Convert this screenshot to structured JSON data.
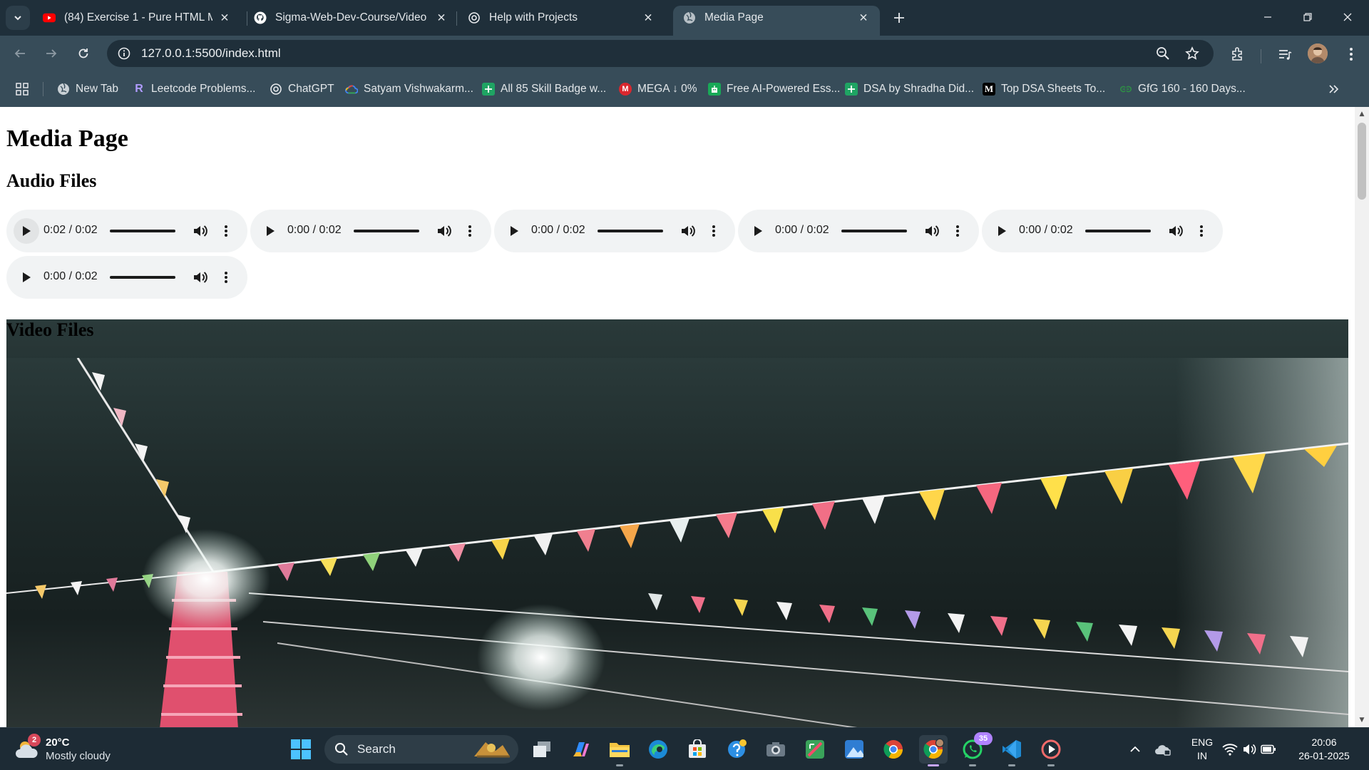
{
  "browser": {
    "tabs": [
      {
        "title": "(84) Exercise 1 - Pure HTML Me",
        "favicon": "youtube-icon",
        "active": false
      },
      {
        "title": "Sigma-Web-Dev-Course/Video",
        "favicon": "github-icon",
        "active": false
      },
      {
        "title": "Help with Projects",
        "favicon": "chatgpt-icon",
        "active": false
      },
      {
        "title": "Media Page",
        "favicon": "globe-icon",
        "active": true
      }
    ],
    "address": "127.0.0.1:5500/index.html",
    "bookmarks": [
      {
        "label": "New Tab",
        "icon": "globe-icon"
      },
      {
        "label": "Leetcode Problems...",
        "icon": "leetcode-icon"
      },
      {
        "label": "ChatGPT",
        "icon": "chatgpt-icon"
      },
      {
        "label": "Satyam Vishwakarm...",
        "icon": "google-cloud-icon"
      },
      {
        "label": "All 85 Skill Badge w...",
        "icon": "sheets-icon"
      },
      {
        "label": "MEGA ↓ 0%",
        "icon": "mega-icon"
      },
      {
        "label": "Free AI-Powered Ess...",
        "icon": "essay-icon"
      },
      {
        "label": "DSA by Shradha Did...",
        "icon": "sheets-icon"
      },
      {
        "label": "Top DSA Sheets To...",
        "icon": "medium-icon"
      },
      {
        "label": "GfG 160 - 160 Days...",
        "icon": "gfg-icon"
      }
    ],
    "bookmark_icon_text": {
      "medium": "M",
      "mega": "M",
      "leetcode": "R"
    }
  },
  "page": {
    "title": "Media Page",
    "audio_heading": "Audio Files",
    "video_heading": "Video Files",
    "audio_players": [
      {
        "time": "0:02 / 0:02",
        "progress": 1.0
      },
      {
        "time": "0:00 / 0:02",
        "progress": 0.0
      },
      {
        "time": "0:00 / 0:02",
        "progress": 0.0
      },
      {
        "time": "0:00 / 0:02",
        "progress": 0.0
      },
      {
        "time": "0:00 / 0:02",
        "progress": 0.0
      },
      {
        "time": "0:00 / 0:02",
        "progress": 0.0
      }
    ]
  },
  "taskbar": {
    "weather": {
      "temp": "20°C",
      "condition": "Mostly cloudy",
      "badge": "2"
    },
    "search_label": "Search",
    "whatsapp_badge": "35",
    "language": {
      "line1": "ENG",
      "line2": "IN"
    },
    "clock": {
      "time": "20:06",
      "date": "26-01-2025"
    }
  },
  "colors": {
    "tabstrip": "#1f2f3a",
    "toolbar": "#374c59",
    "taskbar": "#1d2b35",
    "player_bg": "#f1f3f4"
  }
}
